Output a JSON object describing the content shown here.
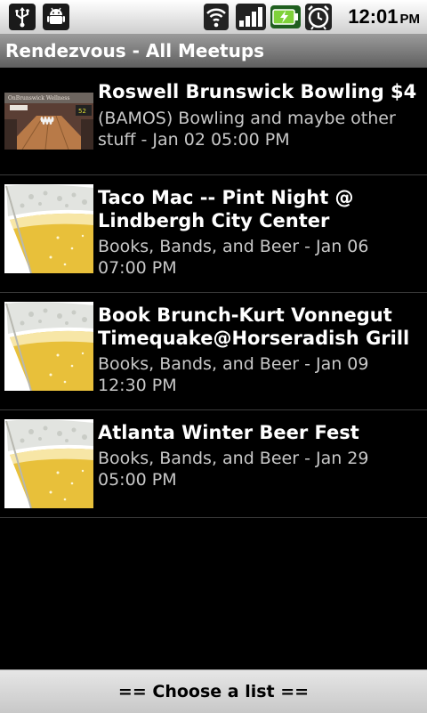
{
  "status_bar": {
    "icons_left": [
      "usb-icon",
      "android-icon"
    ],
    "icons_right": [
      "wifi-icon",
      "signal-icon",
      "battery-icon",
      "alarm-icon"
    ],
    "time": "12:01",
    "ampm": "PM"
  },
  "title_bar": {
    "title": "Rendezvous - All Meetups"
  },
  "meetups": [
    {
      "title": "Roswell Brunswick Bowling $4",
      "subtitle": "(BAMOS) Bowling and maybe other stuff - Jan 02 05:00 PM",
      "thumbnail_text": "OnBrunswick Wellness",
      "icon": "bowling-photo"
    },
    {
      "title": "Taco Mac -- Pint Night @ Lindbergh City Center",
      "subtitle": "Books, Bands, and Beer - Jan 06 07:00 PM",
      "icon": "beer-glass-photo"
    },
    {
      "title": "Book Brunch-Kurt Vonnegut Timequake@Horseradish Grill",
      "subtitle": "Books, Bands, and Beer - Jan 09 12:30 PM",
      "icon": "beer-glass-photo"
    },
    {
      "title": "Atlanta Winter Beer Fest",
      "subtitle": "Books, Bands, and Beer - Jan 29 05:00 PM",
      "icon": "beer-glass-photo"
    }
  ],
  "bottom_button": {
    "label": "== Choose a list =="
  },
  "colors": {
    "background": "#000000",
    "title_bar": "#7a7a7a",
    "subtitle_text": "#c8c8c8",
    "beer": "#e8c03a"
  }
}
